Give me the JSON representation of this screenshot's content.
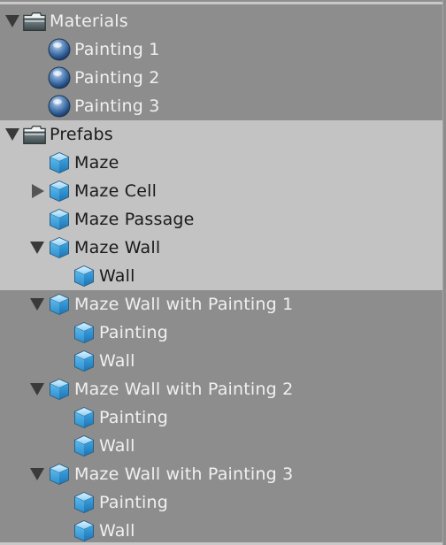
{
  "tree": [
    {
      "label": "Materials",
      "icon": "folder-icon",
      "depth": 0,
      "expanded": true,
      "has_children": true,
      "selected": false
    },
    {
      "label": "Painting 1",
      "icon": "material-sphere-icon",
      "depth": 1,
      "has_children": false,
      "selected": false
    },
    {
      "label": "Painting 2",
      "icon": "material-sphere-icon",
      "depth": 1,
      "has_children": false,
      "selected": false
    },
    {
      "label": "Painting 3",
      "icon": "material-sphere-icon",
      "depth": 1,
      "has_children": false,
      "selected": false
    },
    {
      "label": "Prefabs",
      "icon": "folder-icon",
      "depth": 0,
      "expanded": true,
      "has_children": true,
      "selected": true
    },
    {
      "label": "Maze",
      "icon": "prefab-cube-icon",
      "depth": 1,
      "has_children": false,
      "selected": true
    },
    {
      "label": "Maze Cell",
      "icon": "prefab-cube-icon",
      "depth": 1,
      "expanded": false,
      "has_children": true,
      "selected": true
    },
    {
      "label": "Maze Passage",
      "icon": "prefab-cube-icon",
      "depth": 1,
      "has_children": false,
      "selected": true
    },
    {
      "label": "Maze Wall",
      "icon": "prefab-cube-icon",
      "depth": 1,
      "expanded": true,
      "has_children": true,
      "selected": true
    },
    {
      "label": "Wall",
      "icon": "prefab-cube-icon",
      "depth": 2,
      "has_children": false,
      "selected": true
    },
    {
      "label": "Maze Wall with Painting 1",
      "icon": "prefab-cube-icon",
      "depth": 1,
      "expanded": true,
      "has_children": true,
      "selected": false
    },
    {
      "label": "Painting",
      "icon": "prefab-cube-icon",
      "depth": 2,
      "has_children": false,
      "selected": false
    },
    {
      "label": "Wall",
      "icon": "prefab-cube-icon",
      "depth": 2,
      "has_children": false,
      "selected": false
    },
    {
      "label": "Maze Wall with Painting 2",
      "icon": "prefab-cube-icon",
      "depth": 1,
      "expanded": true,
      "has_children": true,
      "selected": false
    },
    {
      "label": "Painting",
      "icon": "prefab-cube-icon",
      "depth": 2,
      "has_children": false,
      "selected": false
    },
    {
      "label": "Wall",
      "icon": "prefab-cube-icon",
      "depth": 2,
      "has_children": false,
      "selected": false
    },
    {
      "label": "Maze Wall with Painting 3",
      "icon": "prefab-cube-icon",
      "depth": 1,
      "expanded": true,
      "has_children": true,
      "selected": false
    },
    {
      "label": "Painting",
      "icon": "prefab-cube-icon",
      "depth": 2,
      "has_children": false,
      "selected": false
    },
    {
      "label": "Wall",
      "icon": "prefab-cube-icon",
      "depth": 2,
      "has_children": false,
      "selected": false
    }
  ],
  "colors": {
    "background": "#8d8d8d",
    "selection": "#c3c3c3",
    "text_light": "#f0f0f0",
    "text_dark": "#1a1a1a",
    "cube_blue": "#4aa6dc"
  }
}
